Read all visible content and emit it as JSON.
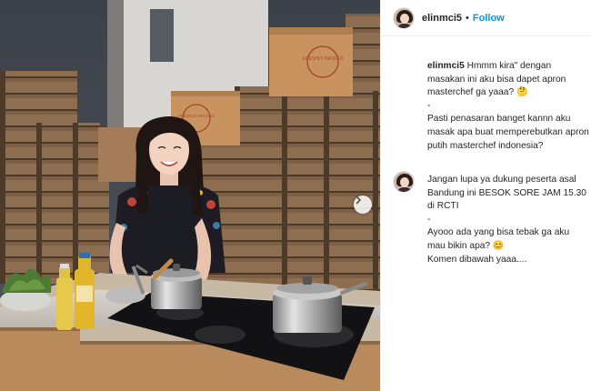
{
  "post": {
    "username": "elinmci5",
    "separator": "•",
    "follow_label": "Follow"
  },
  "caption": {
    "username": "elinmci5",
    "text": "Hmmm kira\" dengan masakan ini aku bisa dapet apron masterchef ga yaaa? 🤔\n-\nPasti penasaran banget kannn aku masak apa buat memperebutkan apron putih masterchef indonesia?"
  },
  "comment": {
    "text": "Jangan lupa ya dukung peserta asal Bandung ini BESOK SORE JAM 15.30 di RCTI\n-\nAyooo ada yang bisa tebak ga aku mau bikin apa? 😊\nKomen dibawah yaaa...."
  },
  "media": {
    "box_label_1": "FRESHLY PACKED",
    "box_label_2": "FRESHLY PACKED",
    "next_icon": "chevron-right-icon"
  },
  "colors": {
    "follow": "#0095f6",
    "crate": "#8a6a4e",
    "box": "#c9935f",
    "counter": "#c7b9a4"
  }
}
